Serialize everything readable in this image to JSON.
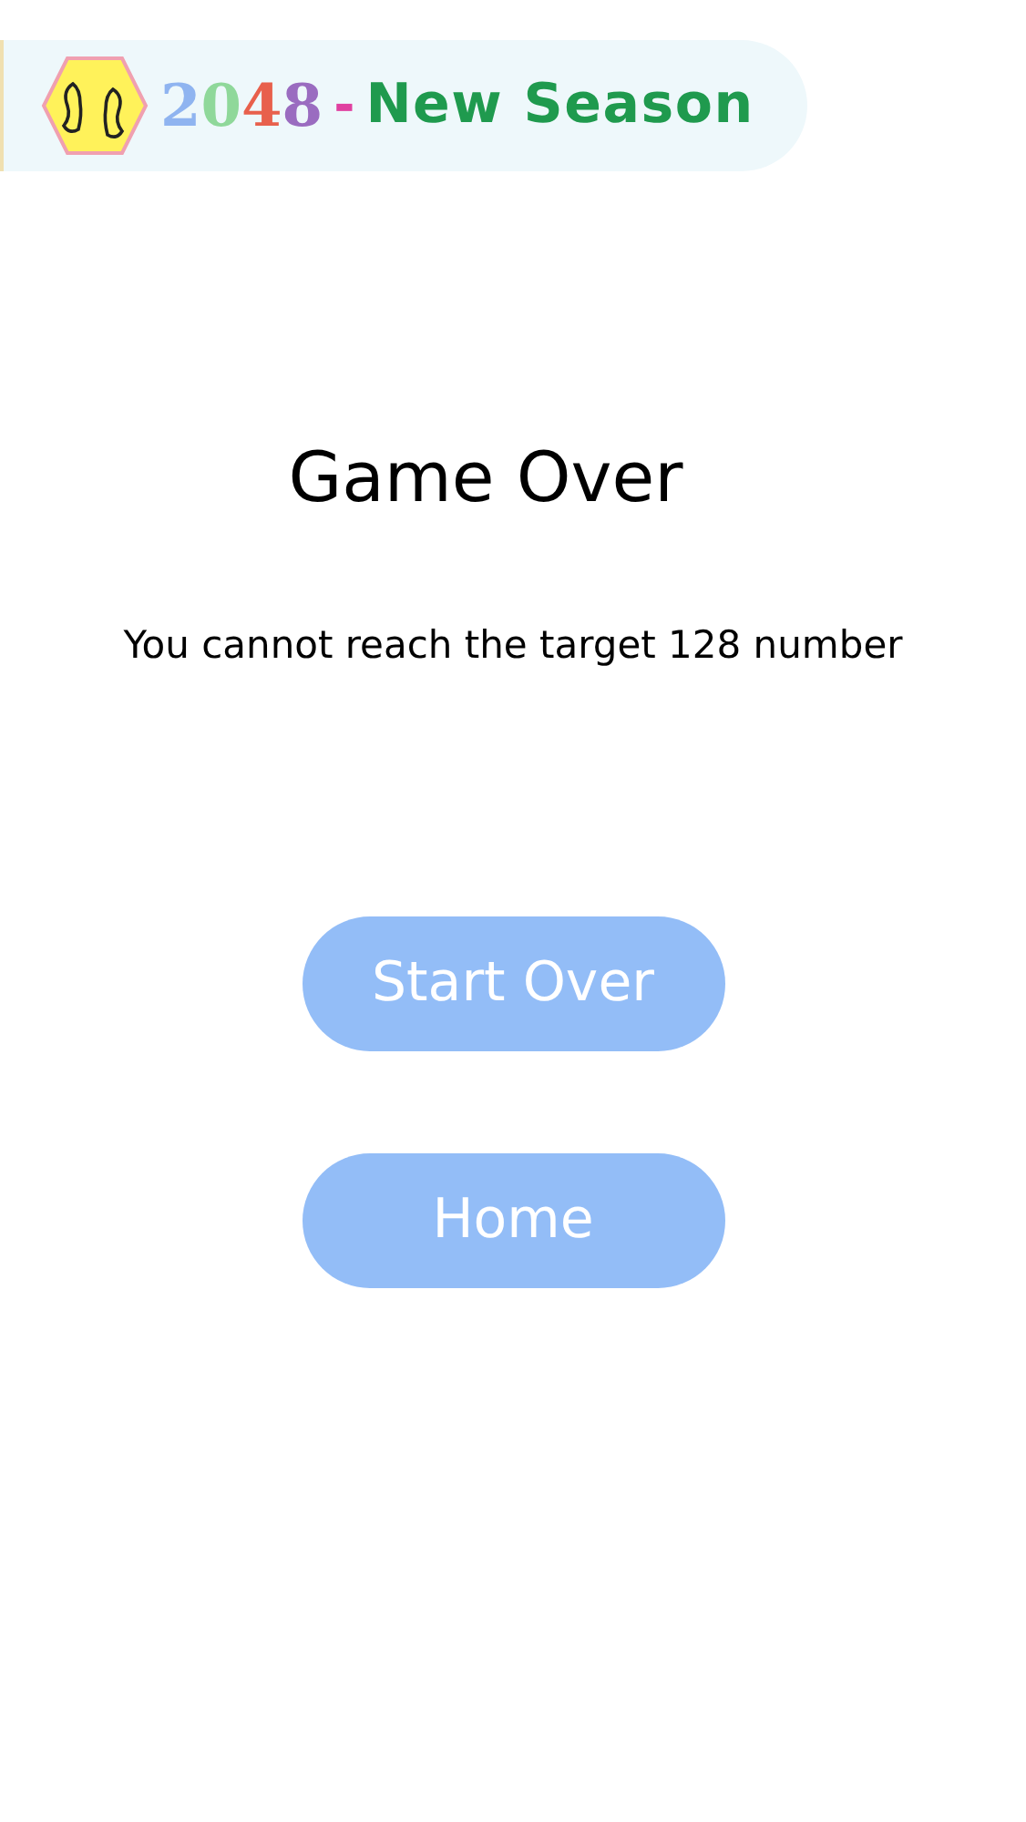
{
  "banner": {
    "digits": [
      {
        "text": "2",
        "color": "#8fb4f0"
      },
      {
        "text": "0",
        "color": "#8fd89a"
      },
      {
        "text": "4",
        "color": "#e8604c"
      },
      {
        "text": "8",
        "color": "#9a6cc0"
      }
    ],
    "dash": "-",
    "title": "New Season"
  },
  "heading": "Game Over",
  "message": "You cannot reach the target 128 number",
  "buttons": [
    "Start Over",
    "Home"
  ]
}
